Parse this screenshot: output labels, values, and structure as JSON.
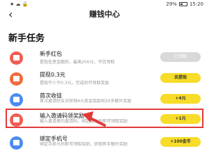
{
  "status_bar": {
    "left": "★ ☁ 🔒",
    "right": "29%",
    "time": "15:20"
  },
  "header": {
    "back_icon": "‹",
    "title": "赚钱中心"
  },
  "section": {
    "title": "新手任务"
  },
  "tasks": [
    {
      "title": "新手红包",
      "desc": "提现任意金额后，最高200元，不信领取",
      "button": "已领取",
      "icon_color": "#f25c53",
      "done": true
    },
    {
      "title": "提现0.3元",
      "desc": "提现不少于0.3元，完成后可领取奖励",
      "button": "去提现",
      "icon_color": "#f26a3c",
      "done": false
    },
    {
      "title": "首次收徒",
      "desc": "首次邀请好友对获得4元现金奖励和20多额外奖励",
      "button": "+4元",
      "icon_color": "#4a8bf0",
      "done": false
    },
    {
      "title": "输入邀请码领奖励",
      "desc": "输入邀请者的邀请码，绑定成功后即可领取奖励",
      "button": "+1元",
      "icon_color": "#f25c53",
      "done": false
    },
    {
      "title": "绑定手机号",
      "desc": "绑定手机号后即可领取奖励，获取新手额外奖励",
      "button": "+100金币",
      "icon_color": "#4a8bf0",
      "done": false
    }
  ],
  "colors": {
    "highlight": "#e23a3a",
    "button_yellow": "#f7dc29",
    "button_done": "#d9d9d9"
  }
}
